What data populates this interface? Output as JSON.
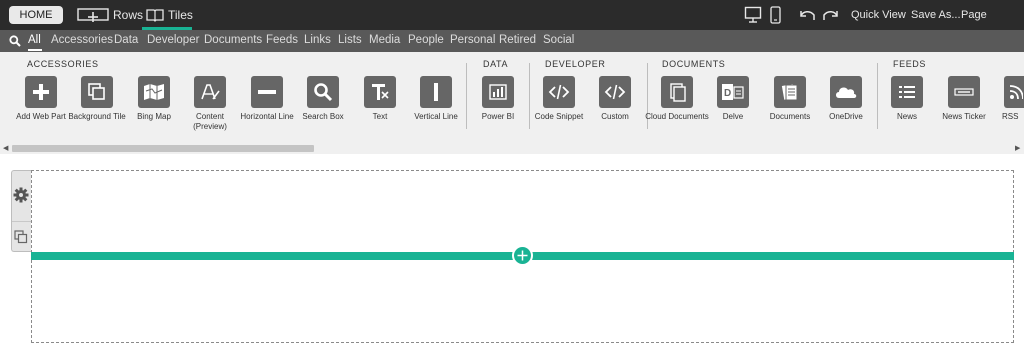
{
  "topbar": {
    "home_label": "HOME",
    "rows_label": "Rows",
    "tiles_label": "Tiles",
    "quick_view_label": "Quick View",
    "save_as_label": "Save As...",
    "page_settings_label": "Page Settings",
    "accent_color": "#19b394"
  },
  "categories": {
    "items": [
      "All",
      "Accessories",
      "Data",
      "Developer",
      "Documents",
      "Feeds",
      "Links",
      "Lists",
      "Media",
      "People",
      "Personal",
      "Retired",
      "Social"
    ],
    "active": "All"
  },
  "gallery": {
    "groups": {
      "accessories": "ACCESSORIES",
      "data": "DATA",
      "developer": "DEVELOPER",
      "documents": "DOCUMENTS",
      "feeds": "FEEDS"
    },
    "tiles": [
      {
        "label": "Add Web Part",
        "icon": "plus-icon"
      },
      {
        "label": "Background Tile",
        "icon": "layers-icon"
      },
      {
        "label": "Bing Map",
        "icon": "map-icon"
      },
      {
        "label": "Content (Preview)",
        "icon": "content-editor-icon"
      },
      {
        "label": "Horizontal Line",
        "icon": "horizontal-line-icon"
      },
      {
        "label": "Search Box",
        "icon": "search-icon"
      },
      {
        "label": "Text",
        "icon": "text-format-icon"
      },
      {
        "label": "Vertical Line",
        "icon": "vertical-line-icon"
      },
      {
        "label": "Power BI",
        "icon": "power-bi-icon"
      },
      {
        "label": "Code Snippet",
        "icon": "code-icon"
      },
      {
        "label": "Custom",
        "icon": "code-icon"
      },
      {
        "label": "Cloud Documents",
        "icon": "cloud-documents-icon"
      },
      {
        "label": "Delve",
        "icon": "delve-icon"
      },
      {
        "label": "Documents",
        "icon": "documents-icon"
      },
      {
        "label": "OneDrive",
        "icon": "cloud-icon"
      },
      {
        "label": "News",
        "icon": "news-list-icon"
      },
      {
        "label": "News Ticker",
        "icon": "news-ticker-icon"
      },
      {
        "label": "RSS",
        "icon": "rss-icon"
      }
    ]
  }
}
